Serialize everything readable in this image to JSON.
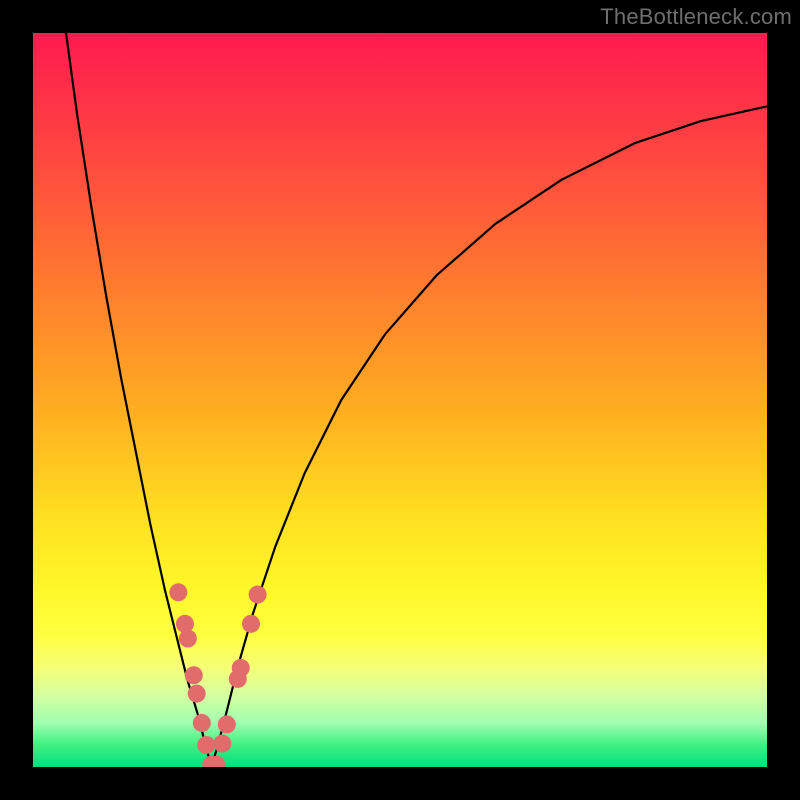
{
  "watermark": "TheBottleneck.com",
  "chart_data": {
    "type": "line",
    "title": "",
    "xlabel": "",
    "ylabel": "",
    "xlim": [
      0,
      100
    ],
    "ylim": [
      0,
      100
    ],
    "grid": false,
    "legend": false,
    "series": [
      {
        "name": "left-curve",
        "x": [
          4.5,
          6,
          8,
          10,
          12,
          14,
          16,
          18,
          19.5,
          21,
          22.5,
          23.5,
          24.3
        ],
        "y": [
          100,
          89,
          76,
          64,
          53,
          43,
          33,
          24,
          18,
          12,
          7,
          3,
          0
        ]
      },
      {
        "name": "right-curve",
        "x": [
          24.3,
          25.2,
          26.5,
          28,
          30,
          33,
          37,
          42,
          48,
          55,
          63,
          72,
          82,
          91,
          100
        ],
        "y": [
          0,
          3,
          8,
          14,
          21,
          30,
          40,
          50,
          59,
          67,
          74,
          80,
          85,
          88,
          90
        ]
      }
    ],
    "markers": {
      "name": "highlight-dots",
      "color": "#e26b6b",
      "points": [
        {
          "x": 19.8,
          "y": 23.8
        },
        {
          "x": 20.7,
          "y": 19.5
        },
        {
          "x": 21.1,
          "y": 17.5
        },
        {
          "x": 21.9,
          "y": 12.5
        },
        {
          "x": 22.3,
          "y": 10.0
        },
        {
          "x": 23.0,
          "y": 6.0
        },
        {
          "x": 23.6,
          "y": 3.0
        },
        {
          "x": 24.3,
          "y": 0.3
        },
        {
          "x": 25.0,
          "y": 0.3
        },
        {
          "x": 25.8,
          "y": 3.2
        },
        {
          "x": 26.4,
          "y": 5.8
        },
        {
          "x": 27.9,
          "y": 12.0
        },
        {
          "x": 28.3,
          "y": 13.5
        },
        {
          "x": 29.7,
          "y": 19.5
        },
        {
          "x": 30.6,
          "y": 23.5
        }
      ]
    }
  }
}
